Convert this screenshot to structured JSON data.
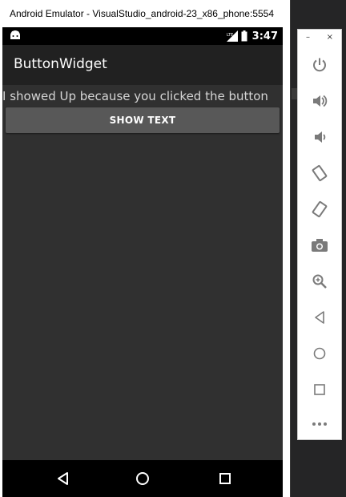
{
  "window": {
    "title": "Android Emulator - VisualStudio_android-23_x86_phone:5554"
  },
  "statusbar": {
    "time": "3:47",
    "network_label": "LTE"
  },
  "app": {
    "title": "ButtonWidget",
    "message": "I showed Up because you clicked the button",
    "button_label": "SHOW TEXT"
  },
  "toolbar": {
    "minimize_label": "–",
    "close_label": "×",
    "icons": [
      "power-icon",
      "volume-up-icon",
      "volume-down-icon",
      "rotate-left-icon",
      "rotate-right-icon",
      "camera-icon",
      "zoom-icon",
      "back-icon",
      "home-icon",
      "overview-icon",
      "more-icon"
    ]
  },
  "colors": {
    "app_background": "#303030",
    "appbar": "#212121",
    "button": "#585858",
    "icon_gray": "#7a7a7a"
  }
}
